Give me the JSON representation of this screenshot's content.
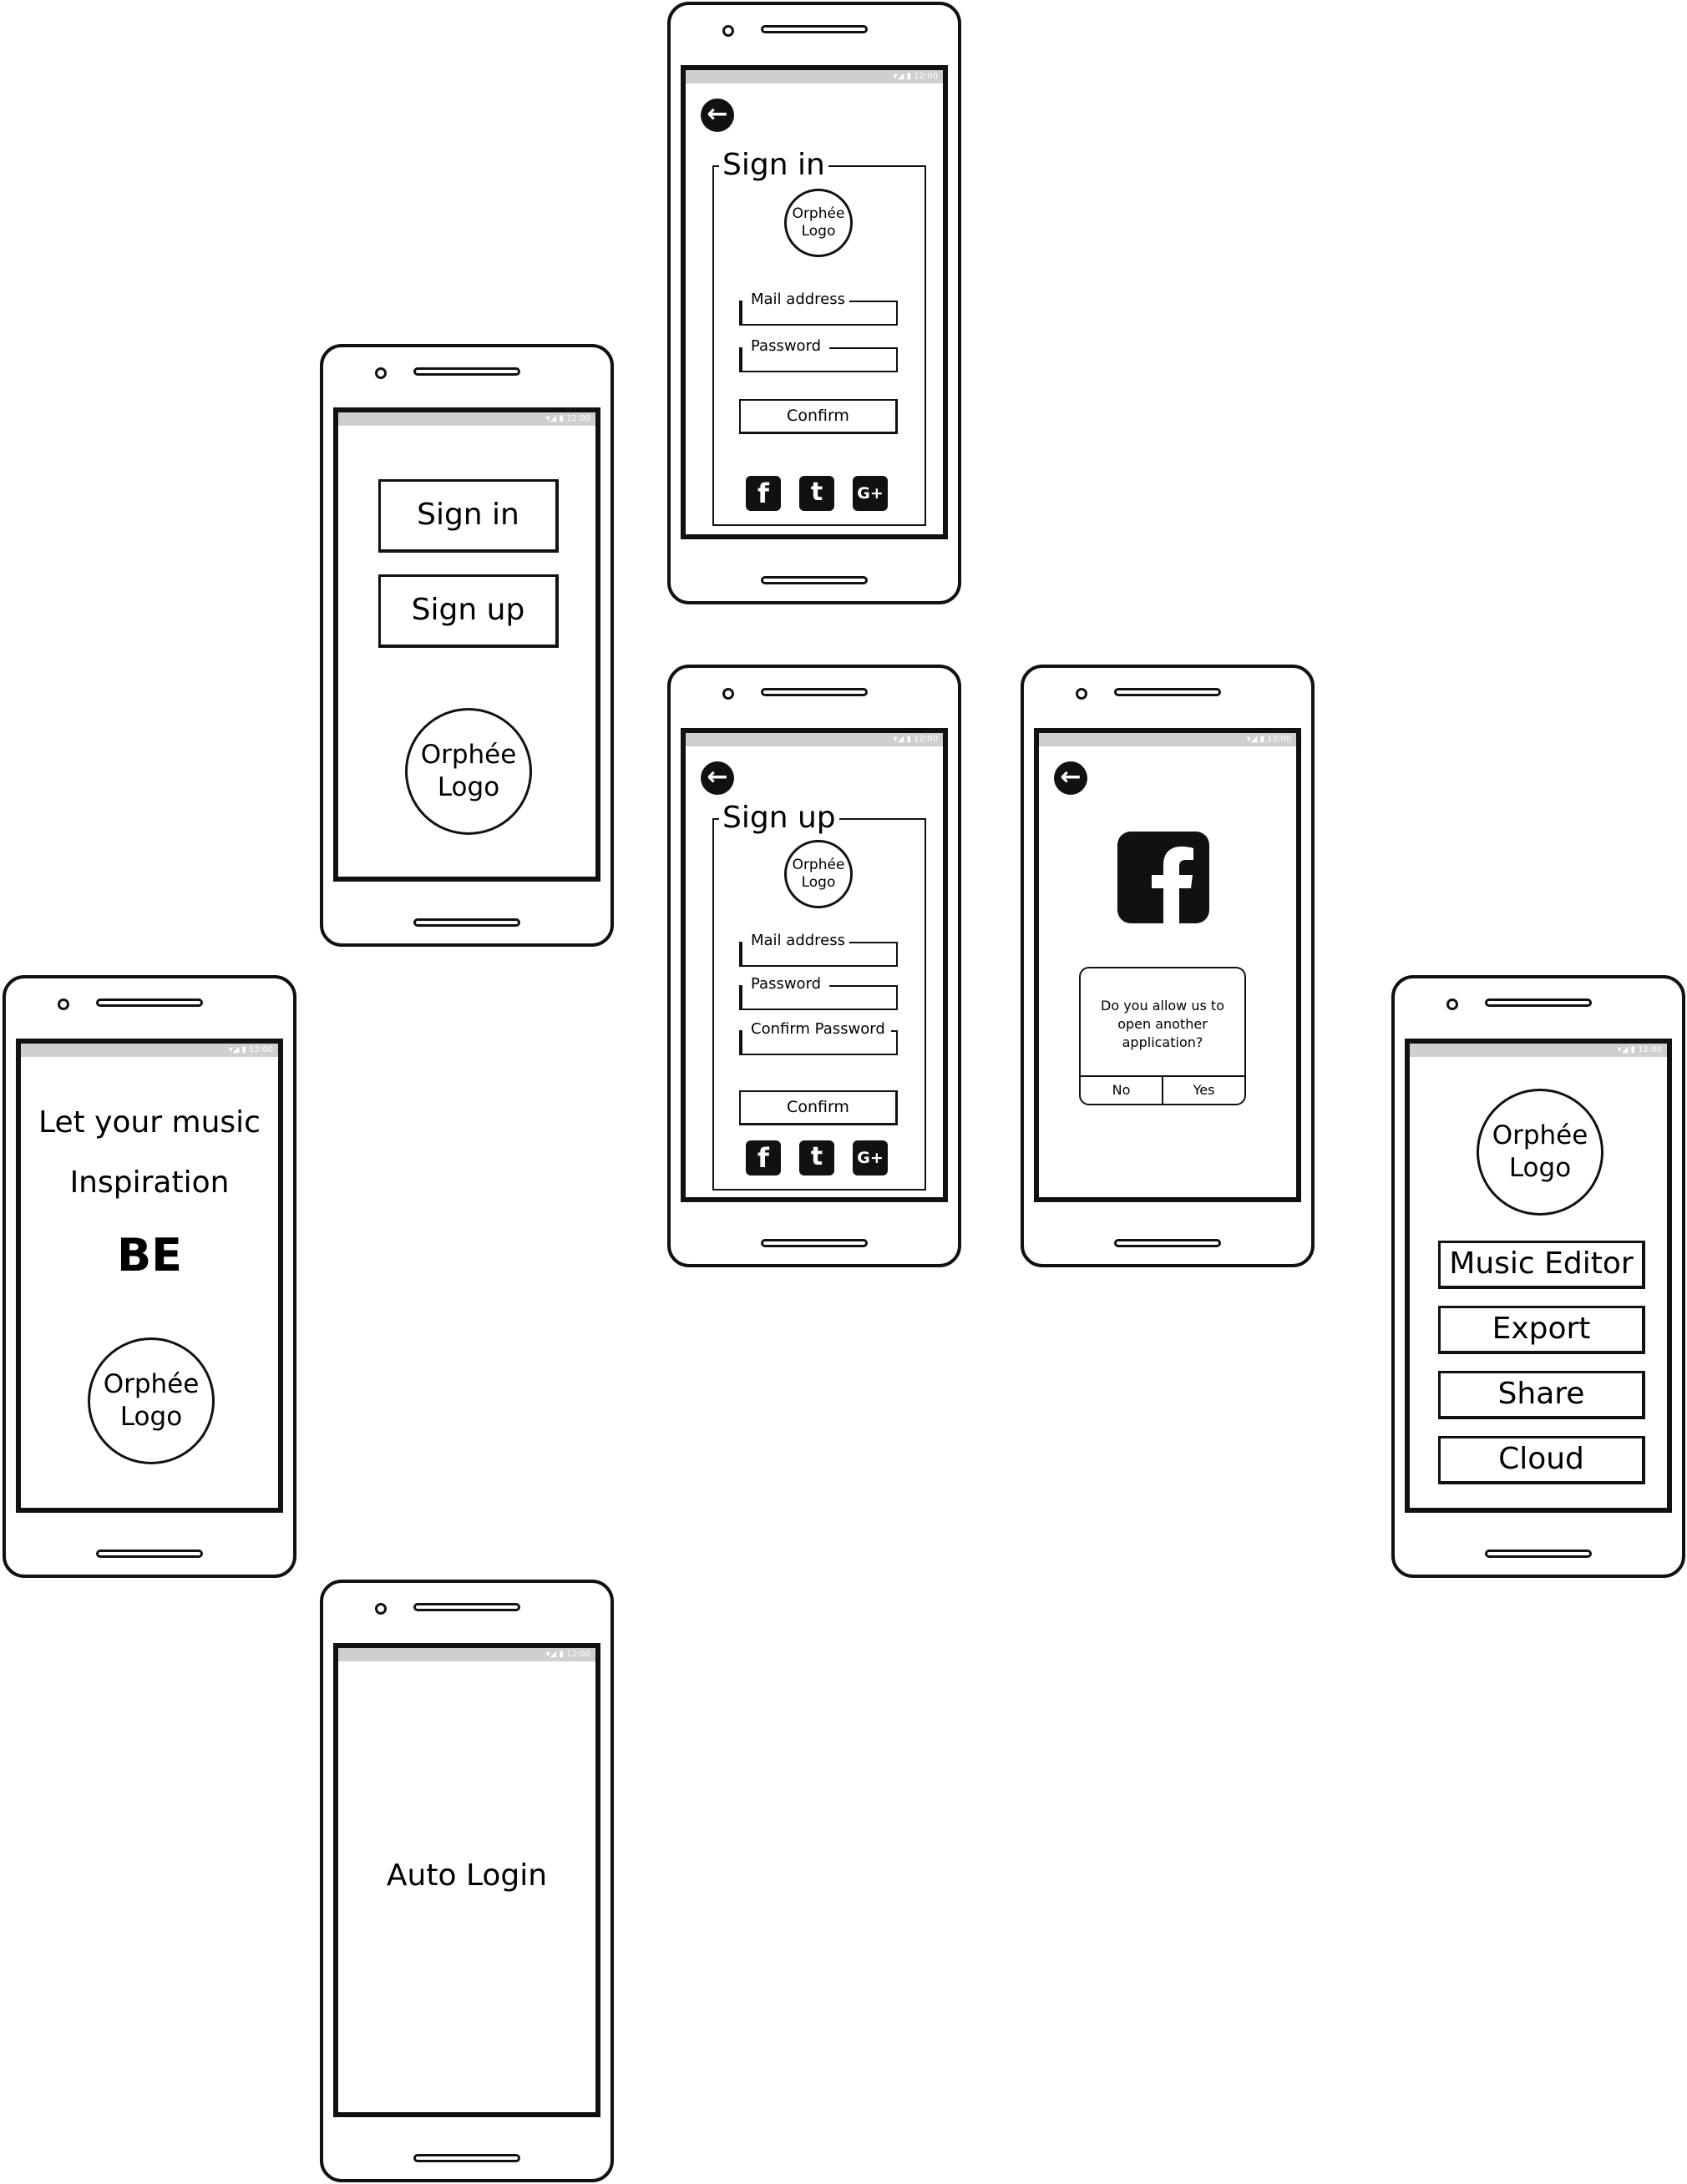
{
  "splash": {
    "line1": "Let your music",
    "line2": "Inspiration",
    "line3": "BE",
    "logo_line1": "Orphée",
    "logo_line2": "Logo"
  },
  "auth_choice": {
    "sign_in": "Sign in",
    "sign_up": "Sign up",
    "logo_line1": "Orphée",
    "logo_line2": "Logo"
  },
  "auto_login": {
    "text": "Auto Login"
  },
  "sign_in_screen": {
    "title": "Sign in",
    "logo_line1": "Orphée",
    "logo_line2": "Logo",
    "mail_label": "Mail address",
    "password_label": "Password",
    "confirm": "Confirm"
  },
  "sign_up_screen": {
    "title": "Sign up",
    "logo_line1": "Orphée",
    "logo_line2": "Logo",
    "mail_label": "Mail address",
    "password_label": "Password",
    "confirm_password_label": "Confirm Password",
    "confirm": "Confirm"
  },
  "facebook_screen": {
    "dialog_line1": "Do you allow us to",
    "dialog_line2": "open another",
    "dialog_line3": "application?",
    "no": "No",
    "yes": "Yes"
  },
  "home_screen": {
    "logo_line1": "Orphée",
    "logo_line2": "Logo",
    "music_editor": "Music Editor",
    "export": "Export",
    "share": "Share",
    "cloud": "Cloud"
  },
  "social_icons": {
    "facebook": "f",
    "twitter": "t",
    "google": "G+"
  }
}
